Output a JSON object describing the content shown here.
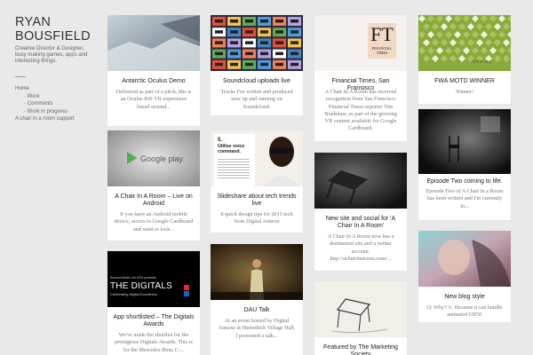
{
  "site": {
    "title": "RYAN BOUSFIELD",
    "tagline": "Creative Director & Designer, busy making games, apps and interesting things."
  },
  "nav": [
    {
      "label": "Home",
      "sub": false
    },
    {
      "label": "Work",
      "sub": true
    },
    {
      "label": "Comments",
      "sub": true
    },
    {
      "label": "Work in progress",
      "sub": true
    },
    {
      "label": "A chair in a room support",
      "sub": false
    }
  ],
  "posts": [
    {
      "title": "Antarctic Oculus Demo",
      "excerpt": "Delivered as part of a pitch, this is an Oculus Rift VR experience based around..."
    },
    {
      "title": "Soundcloud uploads live",
      "excerpt": "Tracks I've written and produced now up and running on Soundcloud."
    },
    {
      "title": "Financial Times, San Fransisco",
      "excerpt": "A Chair In A Room has received recognition from San Francisco Financial Times reporter Tim Bradshaw, as part of the growing VR content available for Google Cardboard."
    },
    {
      "title": "FWA MOTD WINNER",
      "excerpt": "Winner!"
    },
    {
      "title": "A Chair In A Room – Live on Android",
      "excerpt": "If you have an Android mobile device, access to Google Cardboard and want to look..."
    },
    {
      "title": "Slideshare about tech trends live",
      "excerpt": "8 quick design tips for 2015 tech from Digital Annexe"
    },
    {
      "title": "New site and social for 'A Chair In A Room'",
      "excerpt": "A Chair In A Room now has a destination site and a twitter account. http://achairinaroom.com/..."
    },
    {
      "title": "Episode Two coming to life.",
      "excerpt": "Episode Two of A Chair in a Room has been written and I'm currently in..."
    },
    {
      "title": "App shortlisted – The Digitals Awards",
      "excerpt": "We've made the shortlist for the prestigious Digitals Awards. This is for the Mercedes-Benz C-..."
    },
    {
      "title": "DAU Talk",
      "excerpt": "At an event hosted by Digital Annexe at Shoreditch Village Hall, I presented a talk..."
    },
    {
      "title": "New blog style",
      "excerpt": "Q: Why? A: Because it can handle animated GIFS!"
    },
    {
      "title": "Featured by The Marketing Society",
      "excerpt": ""
    }
  ],
  "thumbs": {
    "ft_logo": "FT",
    "ft_name": "FINANCIAL TIMES",
    "google_play": "Google play",
    "slide_number": "5.",
    "slide_heading": "Utilise voice command.",
    "digitals_small": "Summa Annex Ltd 2014 presents",
    "digitals_title": "THE DIGITALS",
    "digitals_sub": "Celebrating Digital Excellence",
    "fwa_text": "of the day"
  },
  "colors": {
    "background": "#e9e9e9",
    "card": "#ffffff",
    "ft_pink": "#f2d9c3",
    "fwa_green": "#8aab3c",
    "digitals_black": "#000000"
  }
}
